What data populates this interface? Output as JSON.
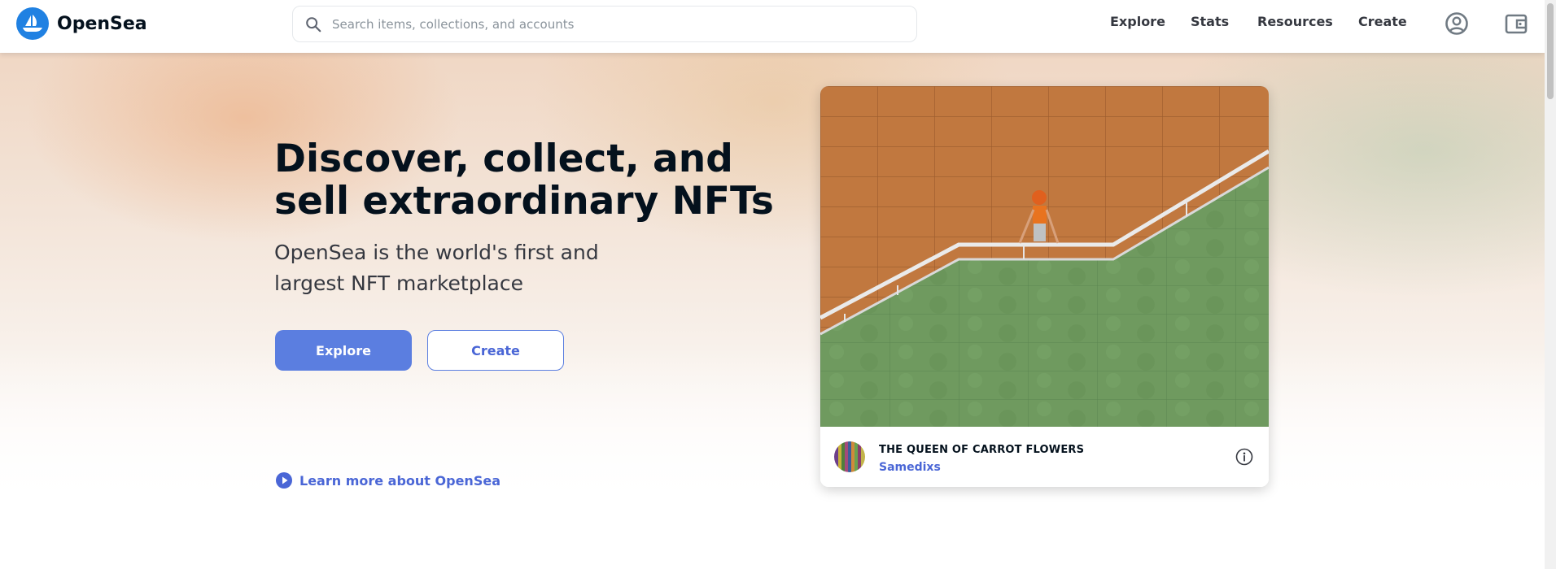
{
  "header": {
    "brand": "OpenSea",
    "search_placeholder": "Search items, collections, and accounts",
    "nav": [
      "Explore",
      "Stats",
      "Resources",
      "Create"
    ],
    "icons": [
      "account-icon",
      "wallet-icon"
    ]
  },
  "hero": {
    "headline": "Discover, collect, and sell extraordinary NFTs",
    "subhead": "OpenSea is the world's first and largest NFT marketplace",
    "primary_button": "Explore",
    "secondary_button": "Create",
    "learn_more": "Learn more about OpenSea"
  },
  "featured": {
    "title": "THE QUEEN OF CARROT FLOWERS",
    "creator": "Samedixs"
  },
  "colors": {
    "brand_blue": "#2081e2",
    "button_blue": "#5b7ee0",
    "link_blue": "#4a66d6"
  }
}
